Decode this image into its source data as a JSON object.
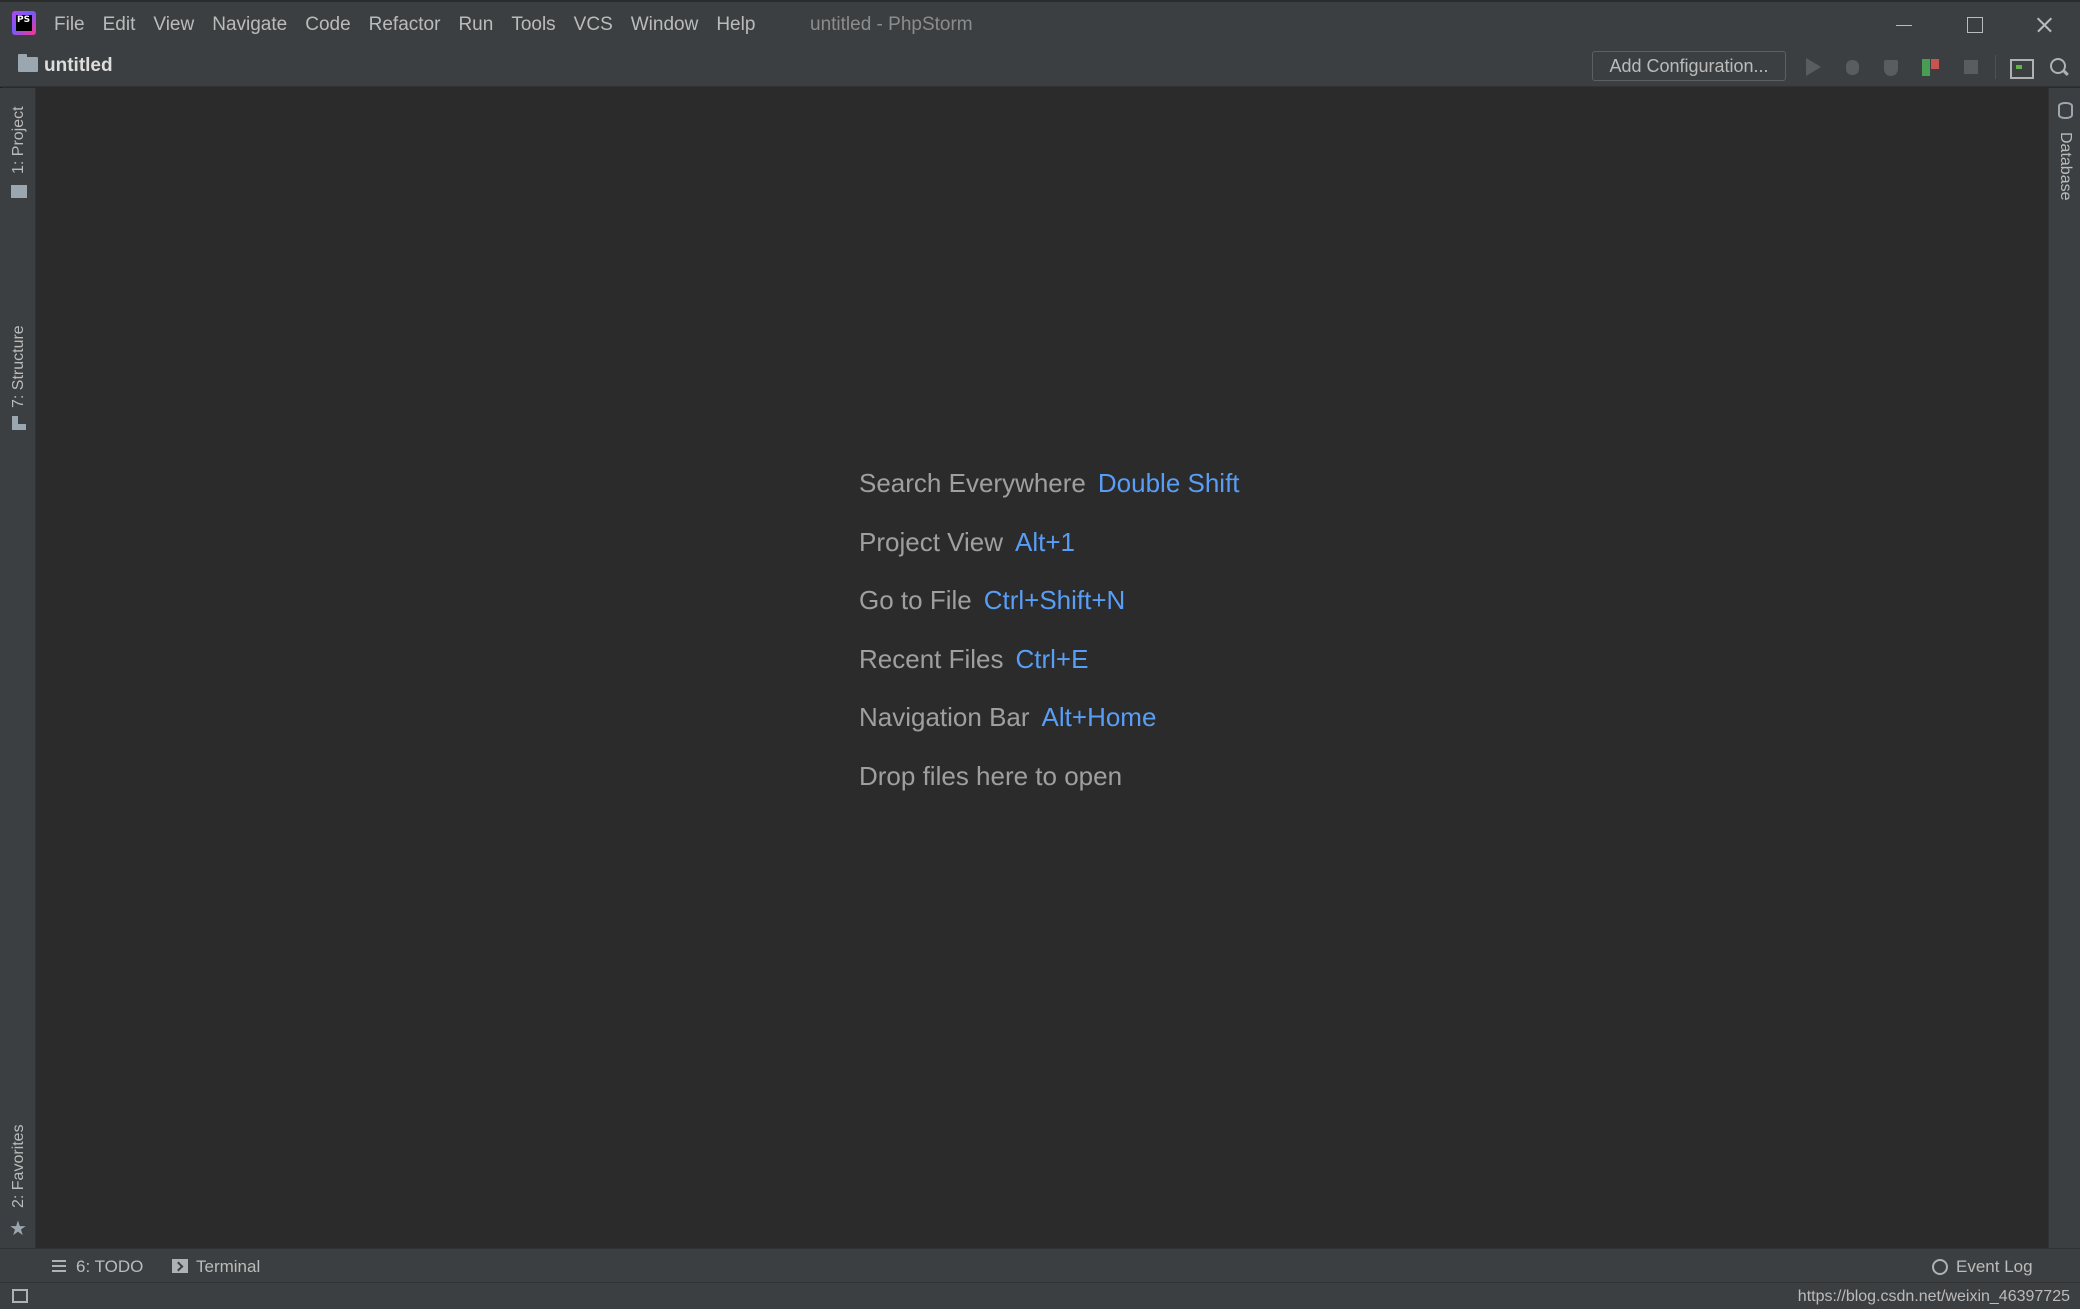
{
  "window": {
    "title": "untitled - PhpStorm",
    "logo_text": "PS"
  },
  "menu": {
    "items": [
      "File",
      "Edit",
      "View",
      "Navigate",
      "Code",
      "Refactor",
      "Run",
      "Tools",
      "VCS",
      "Window",
      "Help"
    ]
  },
  "navbar": {
    "project_name": "untitled",
    "add_configuration_label": "Add Configuration..."
  },
  "left_tool_stripe": {
    "project_tab": "1: Project",
    "structure_tab": "7: Structure",
    "favorites_tab": "2: Favorites"
  },
  "right_tool_stripe": {
    "database_tab": "Database"
  },
  "editor_hints": [
    {
      "label": "Search Everywhere",
      "shortcut": "Double Shift"
    },
    {
      "label": "Project View",
      "shortcut": "Alt+1"
    },
    {
      "label": "Go to File",
      "shortcut": "Ctrl+Shift+N"
    },
    {
      "label": "Recent Files",
      "shortcut": "Ctrl+E"
    },
    {
      "label": "Navigation Bar",
      "shortcut": "Alt+Home"
    },
    {
      "label": "Drop files here to open",
      "shortcut": ""
    }
  ],
  "bottom_tool_stripe": {
    "todo_tab": "6: TODO",
    "terminal_tab": "Terminal",
    "event_log_tab": "Event Log"
  },
  "status_bar": {
    "url_text": "https://blog.csdn.net/weixin_46397725"
  },
  "colors": {
    "background": "#2b2b2b",
    "panel": "#3c3f41",
    "text": "#bbbbbb",
    "shortcut_accent": "#589df6"
  },
  "icons": {
    "logo": "phpstorm-logo-icon",
    "project_folder": "folder-icon",
    "run": "run-icon",
    "debug": "debug-icon",
    "coverage": "coverage-icon",
    "profile": "profile-icon",
    "stop": "stop-icon",
    "terminal_toolbar": "terminal-icon",
    "search": "search-icon",
    "database": "database-icon",
    "favorites": "star-icon",
    "todo": "list-icon",
    "event_log": "event-log-icon"
  }
}
